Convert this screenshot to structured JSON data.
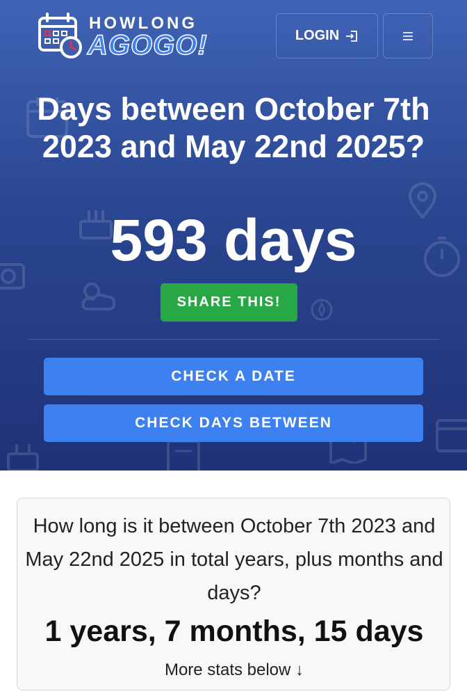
{
  "brand": {
    "line1": "HOWLONG",
    "line2": "AGOGO!",
    "accent_color": "#3d80f5",
    "icon": "calendar-clock-icon"
  },
  "header": {
    "login_label": "LOGIN",
    "login_icon": "sign-in-icon",
    "menu_icon": "hamburger-menu-icon"
  },
  "hero": {
    "headline": "Days between October 7th 2023 and May 22nd 2025?",
    "count": "593 days",
    "share_label": "SHARE THIS!",
    "share_color": "#28a745",
    "background_color": "#2a4690"
  },
  "actions": {
    "check_date_label": "CHECK A DATE",
    "check_between_label": "CHECK DAYS BETWEEN",
    "button_color": "#3d80f0"
  },
  "summary": {
    "question": "How long is it between October 7th 2023 and May 22nd 2025 in total years, plus months and days?",
    "answer": "1 years, 7 months, 15 days",
    "more": "More stats below ↓"
  }
}
